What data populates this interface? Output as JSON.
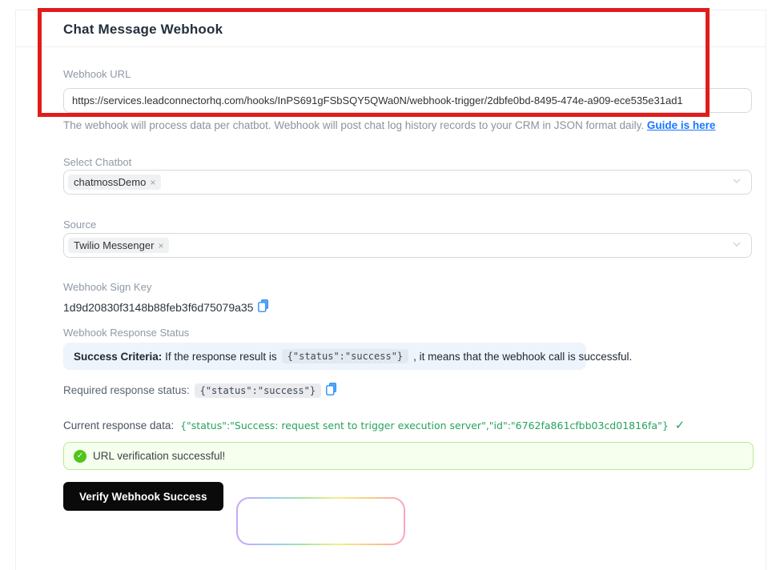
{
  "page": {
    "title": "Chat Message Webhook"
  },
  "webhook_url": {
    "label": "Webhook URL",
    "value": "https://services.leadconnectorhq.com/hooks/InPS691gFSbSQY5QWa0N/webhook-trigger/2dbfe0bd-8495-474e-a909-ece535e31ad1",
    "help_text": "The webhook will process data per chatbot. Webhook will post chat log history records to your CRM in JSON format daily. ",
    "help_link": "Guide is here"
  },
  "select_chatbot": {
    "label": "Select Chatbot",
    "tags": [
      {
        "label": "chatmossDemo",
        "remove": "×"
      }
    ]
  },
  "source": {
    "label": "Source",
    "tags": [
      {
        "label": "Twilio Messenger",
        "remove": "×"
      }
    ]
  },
  "sign_key": {
    "label": "Webhook Sign Key",
    "value": "1d9d20830f3148b88feb3f6d75079a35"
  },
  "response_status": {
    "label": "Webhook Response Status",
    "criteria_bold": "Success Criteria:",
    "criteria_pre": " If the response result is",
    "criteria_code": "{\"status\":\"success\"}",
    "criteria_post": ", it means that the webhook call is successful.",
    "required_label": "Required response status:",
    "required_code": "{\"status\":\"success\"}"
  },
  "current_response": {
    "label": "Current response data:",
    "value": "{\"status\":\"Success: request sent to trigger execution server\",\"id\":\"6762fa861cfbb03cd01816fa\"}",
    "check": "✓"
  },
  "verification_alert": {
    "icon_check": "✓",
    "text": "URL verification successful!"
  },
  "actions": {
    "verify_button": "Verify Webhook Success"
  },
  "colors": {
    "annotation_red": "#e11c1c",
    "link_blue": "#1677ff",
    "copy_blue": "#2f8ef4",
    "success_green": "#27a35d",
    "alert_green_bg": "#f6ffed",
    "alert_green_border": "#b7eb8f",
    "alert_icon_green": "#52c41a",
    "info_blue_bg": "#edf4fc",
    "button_black": "#0a0a0a"
  }
}
